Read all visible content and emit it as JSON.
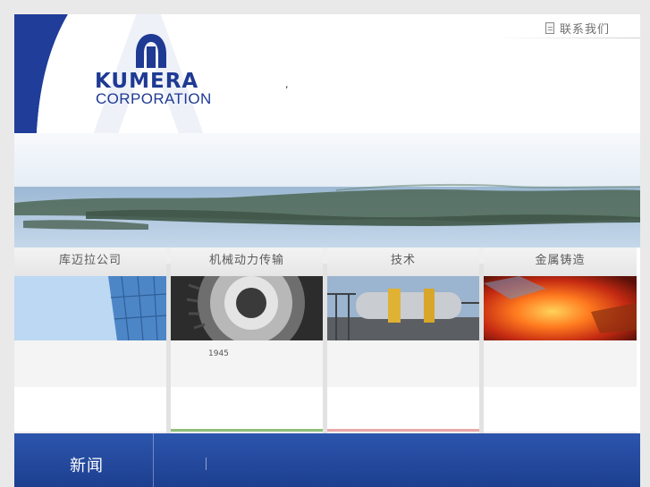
{
  "header": {
    "contact_label": "联系我们",
    "contact_icon": "document-icon",
    "stray_mark": ","
  },
  "logo": {
    "wordmark": "KUMERA",
    "subtitle": "CORPORATION",
    "brand_color": "#1f3a93"
  },
  "categories": [
    {
      "label": "库迈拉公司",
      "text": "",
      "accent": "#5aa0d8"
    },
    {
      "label": "机械动力传输",
      "text": "1945",
      "accent": "#8fc07a"
    },
    {
      "label": "技术",
      "text": "",
      "accent": "#e9a7a7"
    },
    {
      "label": "金属铸造",
      "text": "",
      "accent": "#d8d8d8"
    }
  ],
  "news": {
    "title": "新闻"
  },
  "colors": {
    "accent": "#2c55ad",
    "text_gray": "#6f6f6f"
  }
}
